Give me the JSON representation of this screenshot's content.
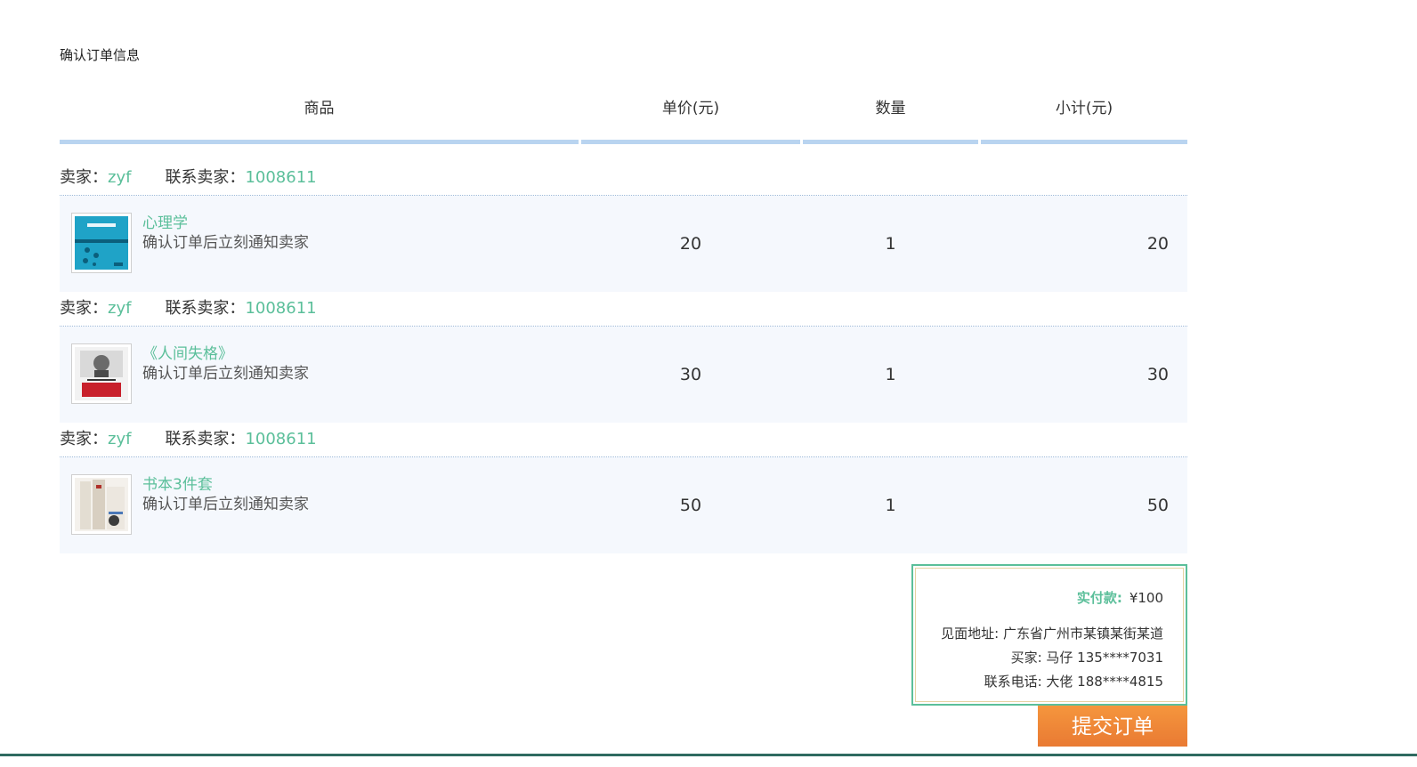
{
  "page": {
    "title": "确认订单信息"
  },
  "table": {
    "headers": {
      "goods": "商品",
      "price": "单价(元)",
      "qty": "数量",
      "subtotal": "小计(元)"
    }
  },
  "seller_label": "卖家：",
  "contact_label": "联系卖家：",
  "orders": [
    {
      "seller": "zyf",
      "contact": "1008611",
      "item_name": "心理学",
      "item_note": "确认订单后立刻通知卖家",
      "price": "20",
      "qty": "1",
      "subtotal": "20",
      "thumb_colors": {
        "bg": "#1fa3c7",
        "accent": "#0b5f7c"
      }
    },
    {
      "seller": "zyf",
      "contact": "1008611",
      "item_name": "《人间失格》",
      "item_note": "确认订单后立刻通知卖家",
      "price": "30",
      "qty": "1",
      "subtotal": "30",
      "thumb_colors": {
        "bg": "#f2f2f2",
        "accent": "#c8202b"
      }
    },
    {
      "seller": "zyf",
      "contact": "1008611",
      "item_name": "书本3件套",
      "item_note": "确认订单后立刻通知卖家",
      "price": "50",
      "qty": "1",
      "subtotal": "50",
      "thumb_colors": {
        "bg": "#e9e4dc",
        "accent": "#7a5a3c"
      }
    }
  ],
  "summary": {
    "pay_label": "实付款:",
    "pay_value": "¥100",
    "address": "见面地址: 广东省广州市某镇某街某道",
    "buyer": "买家: 马仔 135****7031",
    "phone": "联系电话: 大佬 188****4815"
  },
  "submit_label": "提交订单",
  "colors": {
    "accent_green": "#5bbf9a",
    "header_underline": "#b9d4f0",
    "submit_orange": "#f08a3e",
    "row_bg": "#f5f8fd"
  }
}
